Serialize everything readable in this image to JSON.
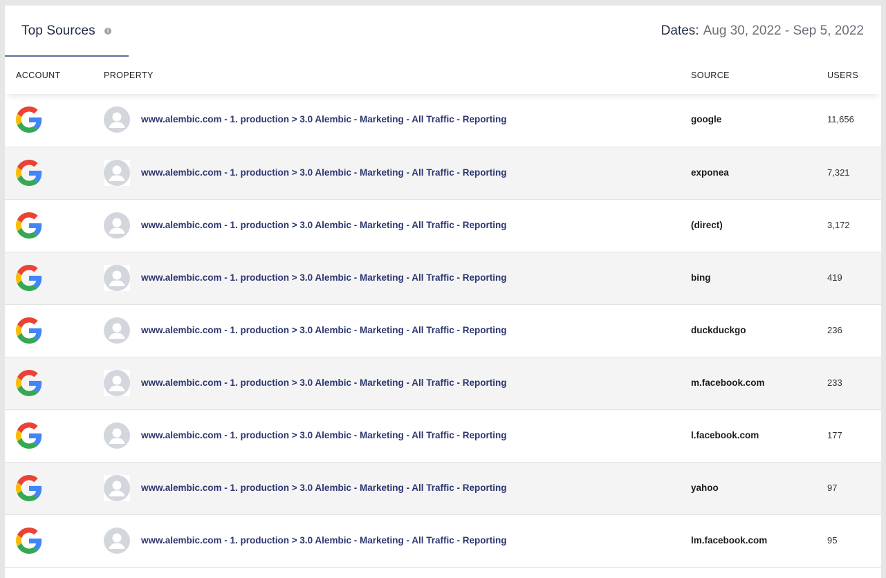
{
  "header": {
    "tab_title": "Top Sources",
    "info_icon": "info-icon",
    "dates_label": "Dates:",
    "dates_range": "Aug 30, 2022 - Sep 5, 2022"
  },
  "columns": {
    "account": "ACCOUNT",
    "property": "PROPERTY",
    "source": "SOURCE",
    "users": "USERS"
  },
  "colors": {
    "link": "#2c3670",
    "tab_underline": "#5a6da0",
    "row_alt": "#f4f4f4"
  },
  "rows": [
    {
      "account_icon": "google-logo-icon",
      "property": "www.alembic.com - 1. production > 3.0 Alembic - Marketing - All Traffic - Reporting",
      "source": "google",
      "users": "11,656"
    },
    {
      "account_icon": "google-logo-icon",
      "property": "www.alembic.com - 1. production > 3.0 Alembic - Marketing - All Traffic - Reporting",
      "source": "exponea",
      "users": "7,321"
    },
    {
      "account_icon": "google-logo-icon",
      "property": "www.alembic.com - 1. production > 3.0 Alembic - Marketing - All Traffic - Reporting",
      "source": "(direct)",
      "users": "3,172"
    },
    {
      "account_icon": "google-logo-icon",
      "property": "www.alembic.com - 1. production > 3.0 Alembic - Marketing - All Traffic - Reporting",
      "source": "bing",
      "users": "419"
    },
    {
      "account_icon": "google-logo-icon",
      "property": "www.alembic.com - 1. production > 3.0 Alembic - Marketing - All Traffic - Reporting",
      "source": "duckduckgo",
      "users": "236"
    },
    {
      "account_icon": "google-logo-icon",
      "property": "www.alembic.com - 1. production > 3.0 Alembic - Marketing - All Traffic - Reporting",
      "source": "m.facebook.com",
      "users": "233"
    },
    {
      "account_icon": "google-logo-icon",
      "property": "www.alembic.com - 1. production > 3.0 Alembic - Marketing - All Traffic - Reporting",
      "source": "l.facebook.com",
      "users": "177"
    },
    {
      "account_icon": "google-logo-icon",
      "property": "www.alembic.com - 1. production > 3.0 Alembic - Marketing - All Traffic - Reporting",
      "source": "yahoo",
      "users": "97"
    },
    {
      "account_icon": "google-logo-icon",
      "property": "www.alembic.com - 1. production > 3.0 Alembic - Marketing - All Traffic - Reporting",
      "source": "lm.facebook.com",
      "users": "95"
    }
  ]
}
